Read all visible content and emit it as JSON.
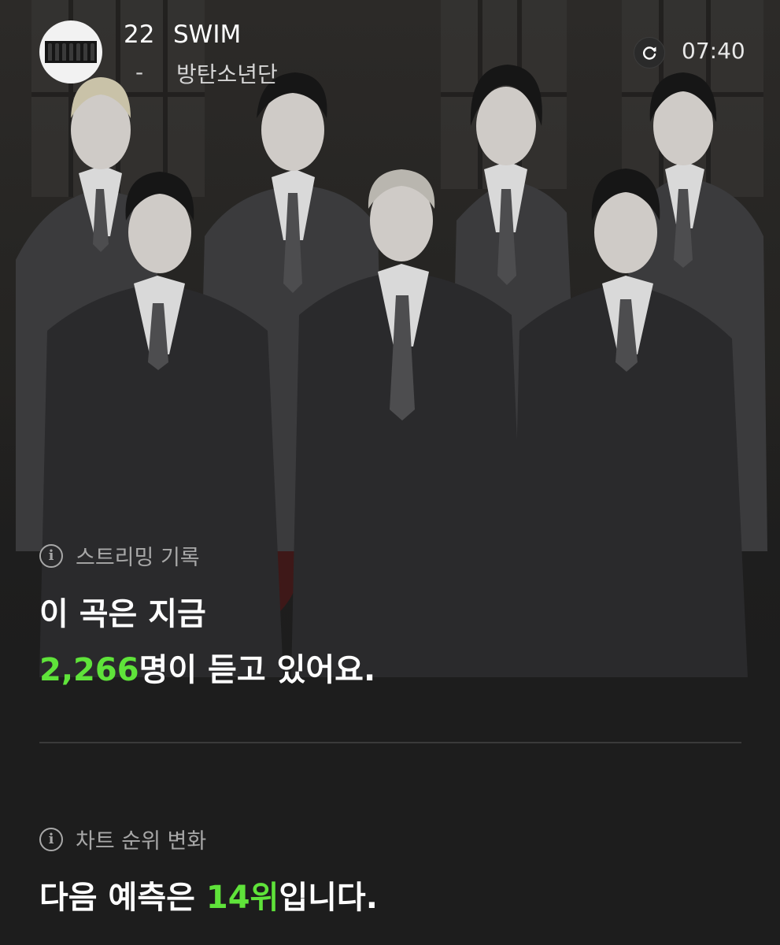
{
  "header": {
    "track_number": "22",
    "track_title": "SWIM",
    "separator": "-",
    "artist": "방탄소년단",
    "time": "07:40",
    "icons": {
      "refresh": "refresh-icon",
      "album": "album-thumbnail"
    }
  },
  "streaming": {
    "label": "스트리밍 기록",
    "line1": "이 곡은 지금",
    "count": "2,266",
    "line2_suffix": "명이 듣고 있어요."
  },
  "chart": {
    "label": "차트 순위 변화",
    "prefix": "다음 예측은 ",
    "rank": "14위",
    "suffix": "입니다."
  },
  "colors": {
    "background": "#1d1d1d",
    "accent_green": "#5fe33a",
    "muted_text": "#a8a8a8",
    "divider": "#3a3a3a"
  }
}
